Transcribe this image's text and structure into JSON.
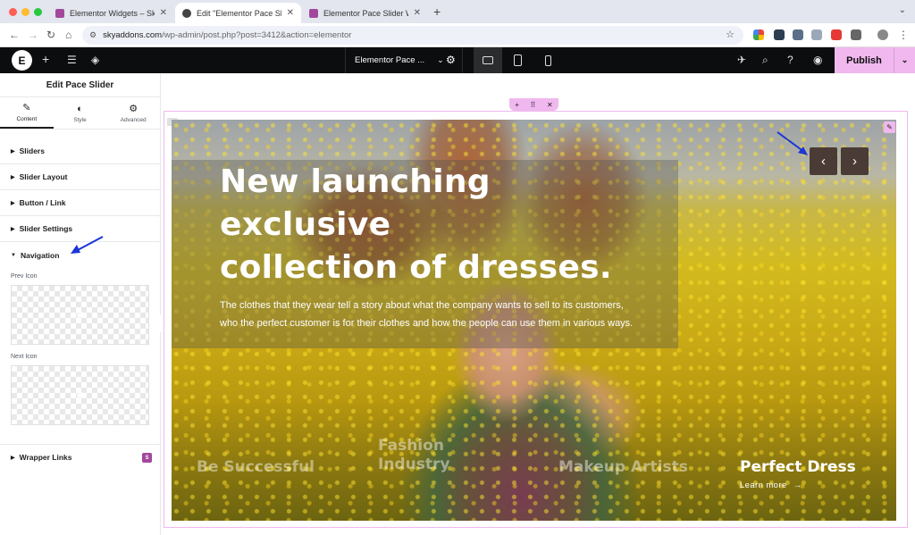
{
  "browser": {
    "tabs": [
      {
        "title": "Elementor Widgets – Sky Addons",
        "active": false,
        "favicon_color": "#a3479d"
      },
      {
        "title": "Edit \"Elementor Pace Slider Widget\"",
        "active": true,
        "favicon_color": "#444444"
      },
      {
        "title": "Elementor Pace Slider Widget",
        "active": false,
        "favicon_color": "#a3479d"
      }
    ],
    "new_tab_icon": "plus-icon",
    "url_host": "skyaddons.com",
    "url_path": "/wp-admin/post.php?post=3412&action=elementor"
  },
  "elementor_bar": {
    "page_selector": "Elementor Pace ...",
    "publish_label": "Publish"
  },
  "panel": {
    "title": "Edit Pace Slider",
    "tabs": [
      {
        "label": "Content",
        "icon": "pencil-icon"
      },
      {
        "label": "Style",
        "icon": "half-circle-icon"
      },
      {
        "label": "Advanced",
        "icon": "gear-icon"
      }
    ],
    "sections": [
      "Sliders",
      "Slider Layout",
      "Button / Link",
      "Slider Settings"
    ],
    "open_section": "Navigation",
    "prev_icon_label": "Prev Icon",
    "next_icon_label": "Next Icon",
    "wrapper_links": "Wrapper Links"
  },
  "slider": {
    "headline_lines": [
      "New launching",
      "exclusive",
      "collection of dresses."
    ],
    "subtitle_lines": [
      "The clothes that they wear tell a story about what the company wants to sell to its customers,",
      "who the perfect customer is for their clothes and how the people can use them in various ways."
    ],
    "prev_arrow": "‹",
    "next_arrow": "›",
    "thumbs": [
      {
        "label": "Be Successful",
        "active": false
      },
      {
        "label_lines": [
          "Fashion",
          "Industry"
        ],
        "active": false
      },
      {
        "label": "Makeup Artists",
        "active": false
      },
      {
        "label": "Perfect Dress",
        "active": true
      }
    ],
    "learn_more": "Learn more"
  },
  "colors": {
    "accent_pink": "#f0b8ee",
    "annotation_arrow": "#1a35d8",
    "nav_button": "#4a3b36"
  }
}
